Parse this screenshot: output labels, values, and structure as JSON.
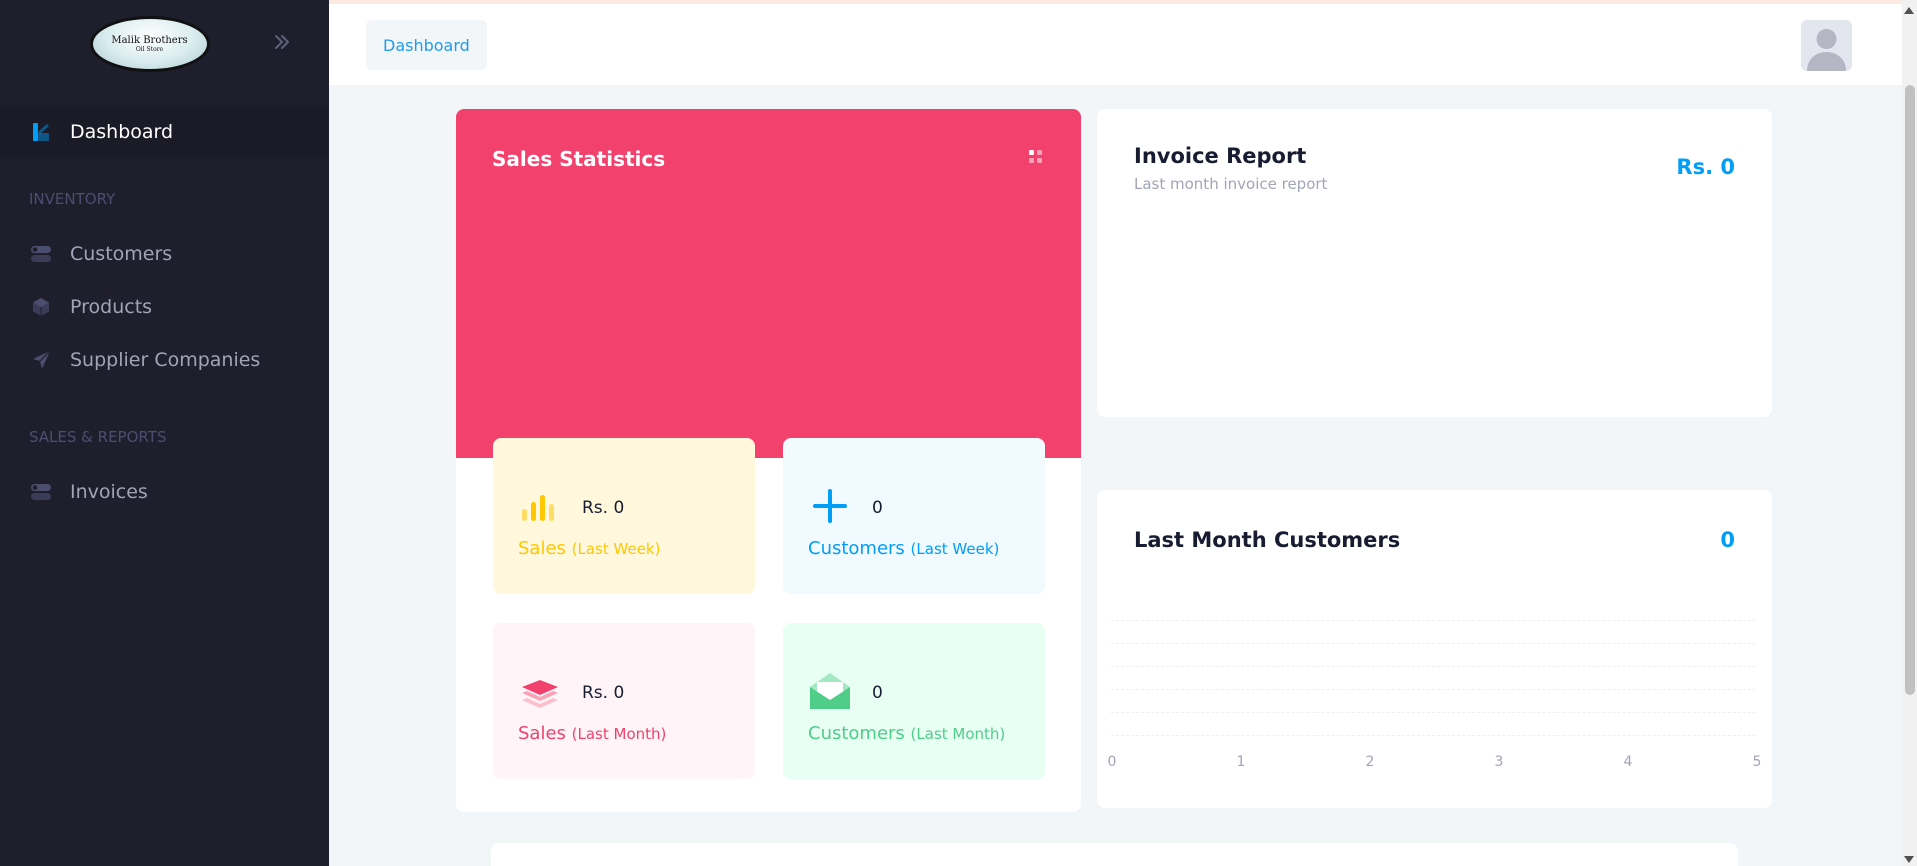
{
  "brand": {
    "line1": "Malik Brothers",
    "line2": "Oil Store"
  },
  "sidebar": {
    "active_item": {
      "label": "Dashboard",
      "icon": "dashboard-icon"
    },
    "sections": [
      {
        "title": "INVENTORY",
        "items": [
          {
            "label": "Customers",
            "icon": "toggle-icon"
          },
          {
            "label": "Products",
            "icon": "cube-icon"
          },
          {
            "label": "Supplier Companies",
            "icon": "send-icon"
          }
        ]
      },
      {
        "title": "SALES & REPORTS",
        "items": [
          {
            "label": "Invoices",
            "icon": "toggle-icon"
          }
        ]
      }
    ]
  },
  "header": {
    "breadcrumb": "Dashboard"
  },
  "sales_statistics": {
    "title": "Sales Statistics",
    "tiles": [
      {
        "value": "Rs. 0",
        "label": "Sales",
        "period": "(Last Week)",
        "icon": "bar-chart-icon"
      },
      {
        "value": "0",
        "label": "Customers",
        "period": "(Last Week)",
        "icon": "plus-icon"
      },
      {
        "value": "Rs. 0",
        "label": "Sales",
        "period": "(Last Month)",
        "icon": "layers-icon"
      },
      {
        "value": "0",
        "label": "Customers",
        "period": "(Last Month)",
        "icon": "envelope-open-icon"
      }
    ]
  },
  "invoice_report": {
    "title": "Invoice Report",
    "subtitle": "Last month invoice report",
    "amount": "Rs. 0"
  },
  "last_month_customers": {
    "title": "Last Month Customers",
    "count": "0",
    "x_ticks": [
      "0",
      "1",
      "2",
      "3",
      "4",
      "5"
    ]
  },
  "colors": {
    "sidebar_bg": "#1e1e2d",
    "primary": "#009ef7",
    "danger": "#f1416c",
    "warning": "#ffc700",
    "success": "#50cd89"
  }
}
